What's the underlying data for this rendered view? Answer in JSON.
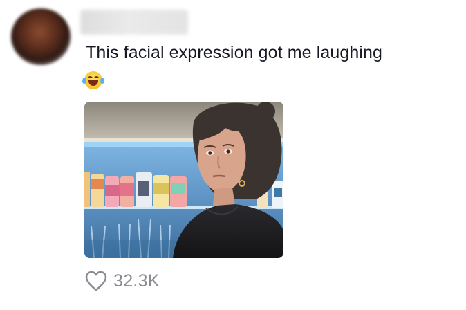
{
  "comment": {
    "text": "This facial expression got me laughing",
    "emoji": "😂",
    "attachment": {
      "kind": "photo"
    },
    "likes": {
      "count_label": "32.3K",
      "icon": "heart-outline-icon"
    }
  },
  "colors": {
    "text": "#161823",
    "muted": "#8a8b91",
    "background": "#ffffff"
  }
}
